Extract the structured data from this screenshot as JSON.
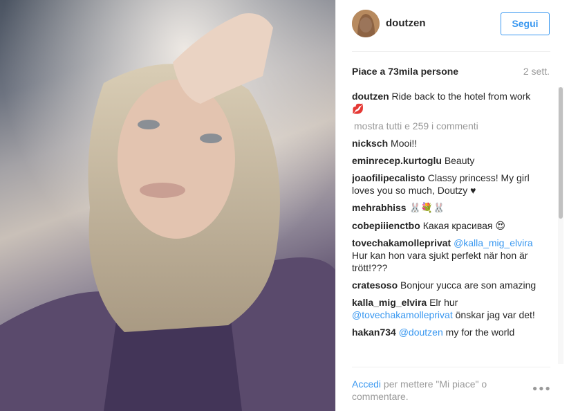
{
  "post": {
    "username": "doutzen",
    "follow_label": "Segui",
    "likes_text": "Piace a 73mila persone",
    "time_text": "2 sett.",
    "caption_user": "doutzen",
    "caption_text": "Ride back to the hotel from work💋",
    "load_more_text": "mostra tutti e 259 i commenti"
  },
  "comments": [
    {
      "user": "nicksch",
      "text": "Mooi!!"
    },
    {
      "user": "eminrecep.kurtoglu",
      "text": "Beauty"
    },
    {
      "user": "joaofilipecalisto",
      "text": "Classy princess! My girl loves you so much, Doutzy ♥"
    },
    {
      "user": "mehrabhiss",
      "text": "🐰💐🐰"
    },
    {
      "user": "cobepiiienctbo",
      "text": "Какая красивая 😍"
    },
    {
      "user": "tovechakamolleprivat",
      "mention": "@kalla_mig_elvira",
      "text": " Hur kan hon vara sjukt perfekt när hon är trött!???"
    },
    {
      "user": "cratesoso",
      "text": "Bonjour yucca are son amazing"
    },
    {
      "user": "kalla_mig_elvira",
      "text": "Elr hur ",
      "mention2": "@tovechakamolleprivat",
      "text2": " önskar jag var det!"
    },
    {
      "user": "hakan734",
      "mention": "@doutzen",
      "text": " my for the world"
    }
  ],
  "footer": {
    "login_label": "Accedi",
    "rest_text": " per mettere \"Mi piace\" o commentare.",
    "more_icon": "more-options-icon"
  },
  "colors": {
    "accent": "#3897f0",
    "muted": "#999999",
    "text": "#262626"
  }
}
